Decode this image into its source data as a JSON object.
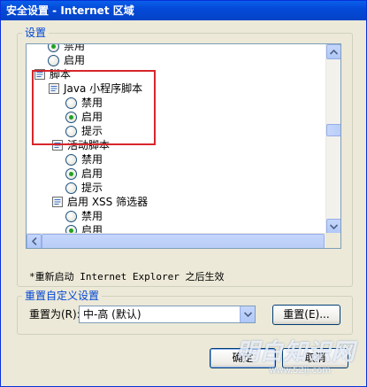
{
  "window": {
    "title": "安全设置 - Internet 区域"
  },
  "settings_group": {
    "label": "设置"
  },
  "tree": {
    "rows": [
      {
        "kind": "radio",
        "label": "禁用",
        "checked": true
      },
      {
        "kind": "radio",
        "label": "启用",
        "checked": false
      },
      {
        "kind": "category",
        "label": "脚本"
      },
      {
        "kind": "category",
        "label": "Java 小程序脚本"
      },
      {
        "kind": "radio",
        "label": "禁用",
        "checked": false
      },
      {
        "kind": "radio",
        "label": "启用",
        "checked": true
      },
      {
        "kind": "radio",
        "label": "提示",
        "checked": false
      },
      {
        "kind": "category",
        "label": "活动脚本"
      },
      {
        "kind": "radio",
        "label": "禁用",
        "checked": false
      },
      {
        "kind": "radio",
        "label": "启用",
        "checked": true
      },
      {
        "kind": "radio",
        "label": "提示",
        "checked": false
      },
      {
        "kind": "category",
        "label": "启用 XSS 筛选器"
      },
      {
        "kind": "radio",
        "label": "禁用",
        "checked": false
      },
      {
        "kind": "radio",
        "label": "启用",
        "checked": true
      }
    ]
  },
  "restart_note": "*重新启动 Internet Explorer 之后生效",
  "reset_group": {
    "label": "重置自定义设置",
    "field_label": "重置为(R):",
    "selected_value": "中-高 (默认)",
    "reset_button": "重置(E)..."
  },
  "footer": {
    "ok_button": "确定",
    "cancel_button": "取消"
  },
  "watermark": {
    "text": "明白知识网",
    "url": "www.52ij.com"
  }
}
